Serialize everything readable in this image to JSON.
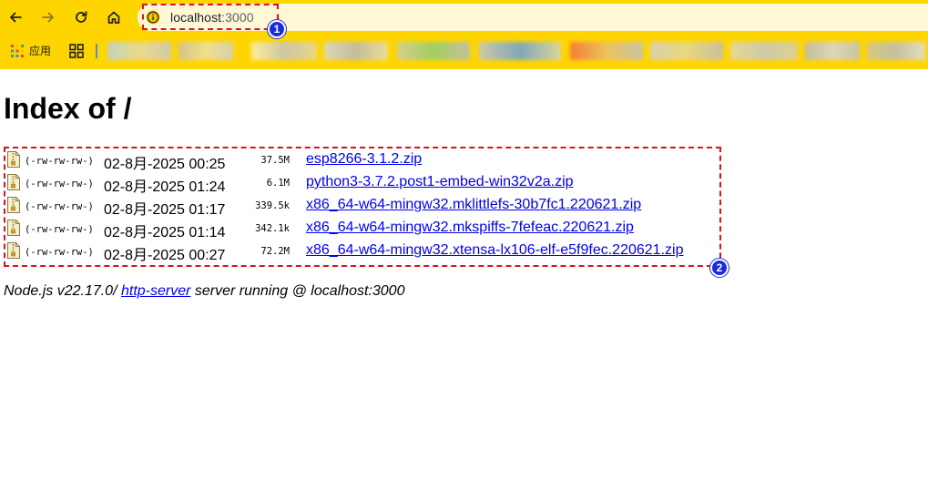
{
  "browser": {
    "nav": {
      "back_icon": "arrow-left-icon",
      "forward_icon": "arrow-right-icon",
      "reload_icon": "reload-icon",
      "home_icon": "home-icon"
    },
    "address": {
      "host": "localhost",
      "port": ":3000",
      "security_icon": "info-icon"
    },
    "bookmarks": {
      "apps_label": "应用",
      "apps_icon": "apps-grid-icon",
      "grid_icon": "grid-icon"
    },
    "theme_color": "#ffd500"
  },
  "page": {
    "title": "Index of /",
    "files": [
      {
        "perms": "(-rw-rw-rw-)",
        "date": "02-8月-2025 00:25",
        "size": "37.5M",
        "name": "esp8266-3.1.2.zip"
      },
      {
        "perms": "(-rw-rw-rw-)",
        "date": "02-8月-2025 01:24",
        "size": "6.1M",
        "name": "python3-3.7.2.post1-embed-win32v2a.zip"
      },
      {
        "perms": "(-rw-rw-rw-)",
        "date": "02-8月-2025 01:17",
        "size": "339.5k",
        "name": "x86_64-w64-mingw32.mklittlefs-30b7fc1.220621.zip"
      },
      {
        "perms": "(-rw-rw-rw-)",
        "date": "02-8月-2025 01:14",
        "size": "342.1k",
        "name": "x86_64-w64-mingw32.mkspiffs-7fefeac.220621.zip"
      },
      {
        "perms": "(-rw-rw-rw-)",
        "date": "02-8月-2025 00:27",
        "size": "72.2M",
        "name": "x86_64-w64-mingw32.xtensa-lx106-elf-e5f9fec.220621.zip"
      }
    ],
    "footer": {
      "prefix": "Node.js v22.17.0/ ",
      "link": "http-server",
      "suffix": " server running @ localhost:3000"
    }
  },
  "annotations": [
    {
      "label": "1",
      "color": "#e0101a",
      "badge_color": "#1a2bd8"
    },
    {
      "label": "2",
      "color": "#e0101a",
      "badge_color": "#1a2bd8"
    }
  ]
}
